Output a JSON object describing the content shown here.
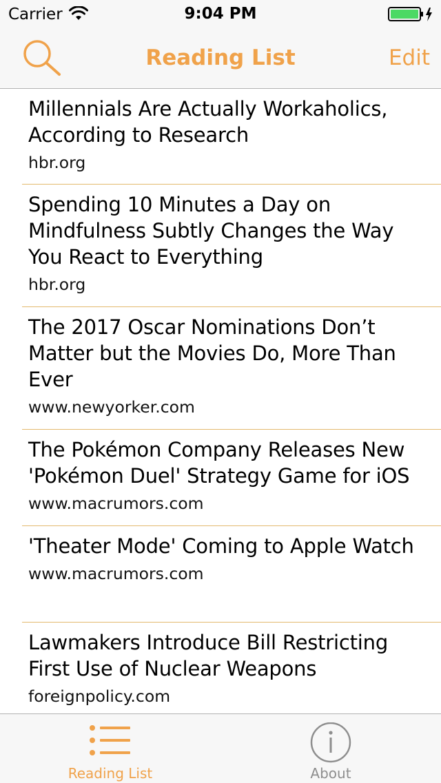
{
  "status_bar": {
    "carrier": "Carrier",
    "time": "9:04 PM"
  },
  "nav_bar": {
    "title": "Reading List",
    "edit_label": "Edit",
    "accent_color": "#f0a24a"
  },
  "items": [
    {
      "title": "Millennials Are Actually Workaholics, According to Research",
      "source": "hbr.org"
    },
    {
      "title": "Spending 10 Minutes a Day on Mindfulness Subtly Changes the Way You React to Everything",
      "source": "hbr.org"
    },
    {
      "title": "The 2017 Oscar Nominations Don’t Matter but the Movies Do, More Than Ever",
      "source": "www.newyorker.com"
    },
    {
      "title": "The Pokémon Company Releases New 'Pokémon Duel' Strategy Game for iOS",
      "source": "www.macrumors.com"
    },
    {
      "title": "'Theater Mode' Coming to Apple Watch",
      "source": "www.macrumors.com"
    },
    {
      "title": "Lawmakers Introduce Bill Restricting First Use of Nuclear Weapons",
      "source": "foreignpolicy.com"
    }
  ],
  "tab_bar": {
    "tabs": [
      {
        "label": "Reading List",
        "icon": "list-icon",
        "selected": true
      },
      {
        "label": "About",
        "icon": "info-icon",
        "selected": false
      }
    ]
  }
}
